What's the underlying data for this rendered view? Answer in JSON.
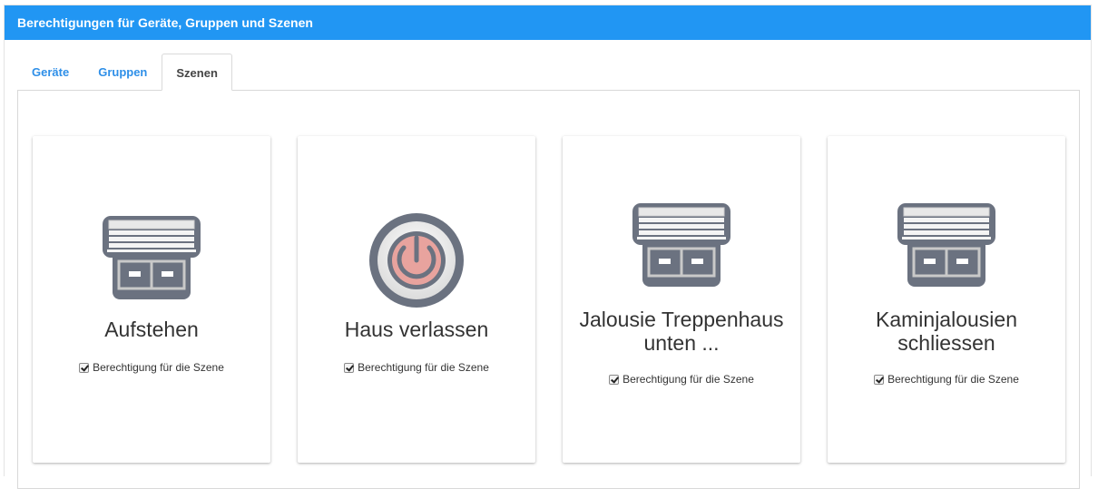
{
  "panel": {
    "title": "Berechtigungen für Geräte, Gruppen und Szenen"
  },
  "tabs": [
    {
      "label": "Geräte",
      "active": false
    },
    {
      "label": "Gruppen",
      "active": false
    },
    {
      "label": "Szenen",
      "active": true
    }
  ],
  "scenes": [
    {
      "title": "Aufstehen",
      "icon": "blind-icon",
      "permission_label": "Berechtigung für die Szene",
      "checked": true
    },
    {
      "title": "Haus verlassen",
      "icon": "power-icon",
      "permission_label": "Berechtigung für die Szene",
      "checked": true
    },
    {
      "title_line1": "Jalousie Treppenhaus",
      "title_line2": "unten ...",
      "icon": "blind-icon",
      "permission_label": "Berechtigung für die Szene",
      "checked": true
    },
    {
      "title_line1": "Kaminjalousien",
      "title_line2": "schliessen",
      "icon": "blind-icon",
      "permission_label": "Berechtigung für die Szene",
      "checked": true
    }
  ],
  "colors": {
    "header": "#2196f3",
    "tab_link": "#2e8fe8",
    "icon_dark": "#6b7280",
    "power_accent": "#e8a39e"
  }
}
